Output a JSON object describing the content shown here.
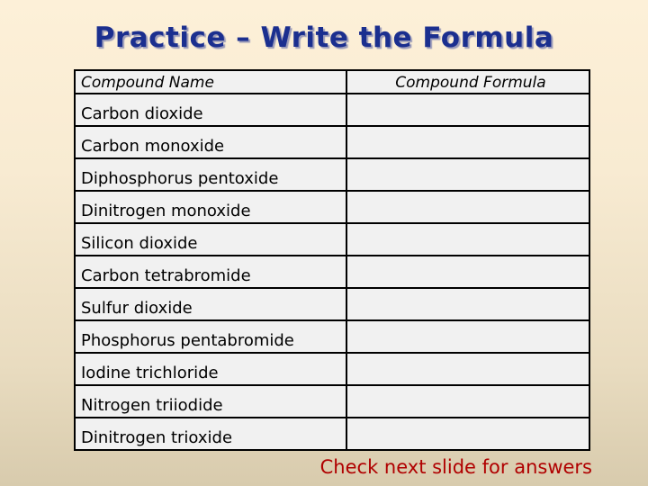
{
  "title": "Practice – Write the Formula",
  "table": {
    "headers": [
      "Compound Name",
      "Compound Formula"
    ],
    "rows": [
      {
        "name": "Carbon dioxide",
        "formula": ""
      },
      {
        "name": "Carbon monoxide",
        "formula": ""
      },
      {
        "name": "Diphosphorus pentoxide",
        "formula": ""
      },
      {
        "name": "Dinitrogen monoxide",
        "formula": ""
      },
      {
        "name": "Silicon dioxide",
        "formula": ""
      },
      {
        "name": "Carbon tetrabromide",
        "formula": ""
      },
      {
        "name": "Sulfur dioxide",
        "formula": ""
      },
      {
        "name": "Phosphorus pentabromide",
        "formula": ""
      },
      {
        "name": "Iodine trichloride",
        "formula": ""
      },
      {
        "name": "Nitrogen triiodide",
        "formula": ""
      },
      {
        "name": "Dinitrogen trioxide",
        "formula": ""
      }
    ]
  },
  "footer_note": "Check next slide for answers",
  "colors": {
    "title": "#1b2f8f",
    "footer_note": "#b00000",
    "table_fill": "#f1f1f1",
    "background_top": "#fdf0d8",
    "background_bottom": "#d8cbad"
  }
}
